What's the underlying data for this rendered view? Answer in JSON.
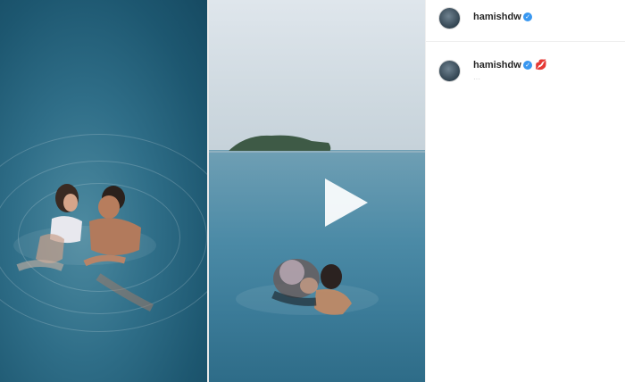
{
  "post": {
    "video_player": {
      "play_icon": "play-icon"
    }
  },
  "header": {
    "username": "hamishdw",
    "verified_icon": "verified-badge-icon"
  },
  "caption": {
    "username": "hamishdw",
    "verified_icon": "verified-badge-icon",
    "text": "💋",
    "timestamp": "···"
  },
  "colors": {
    "verified": "#3897f0",
    "username_text": "#262626",
    "border": "#efefef"
  }
}
